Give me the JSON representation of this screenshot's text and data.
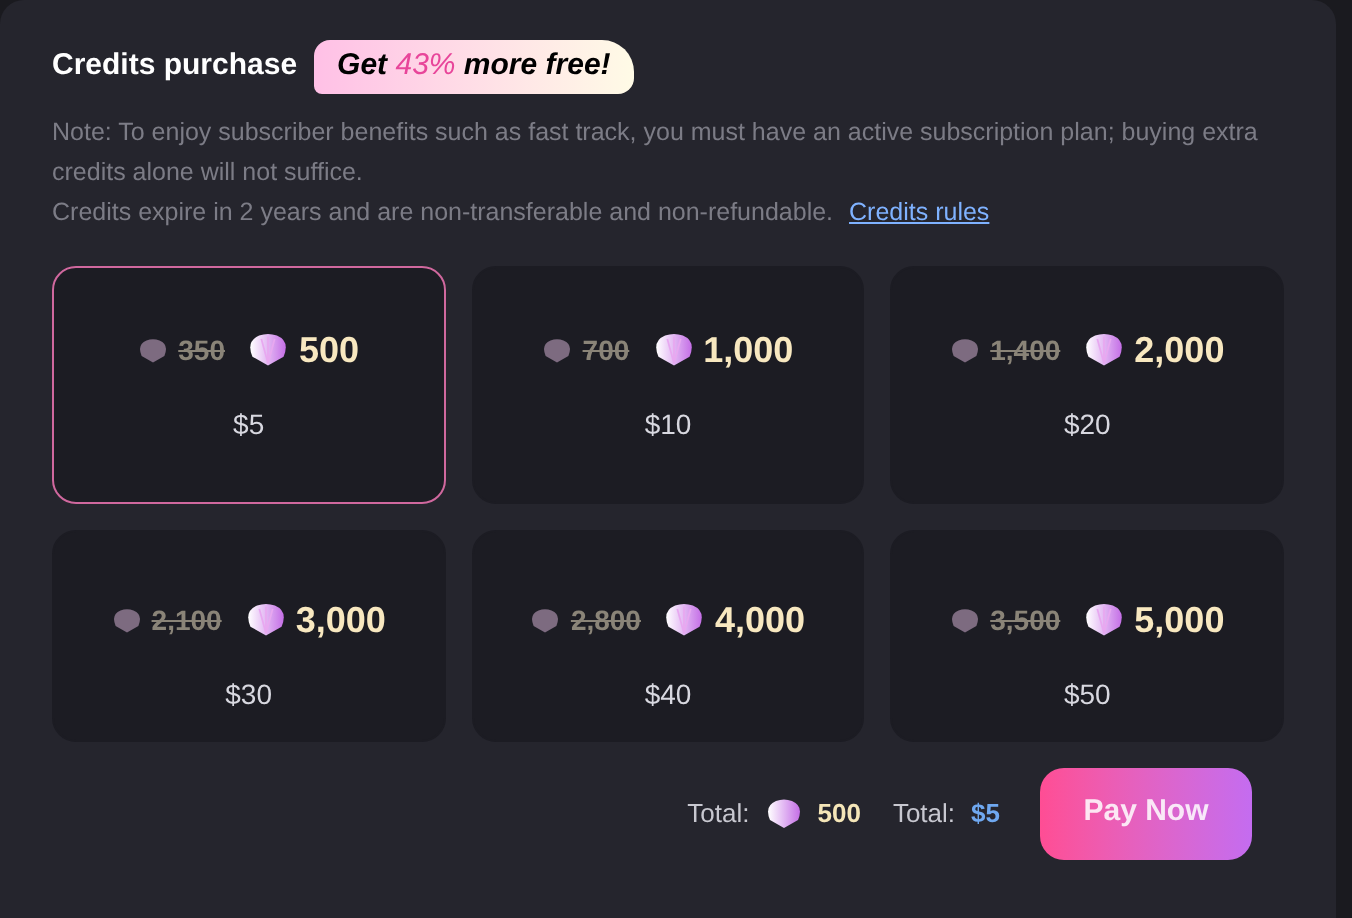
{
  "title": "Credits purchase",
  "badge": {
    "before": "Get",
    "highlight": "43%",
    "after": "more free!"
  },
  "notes": [
    "Note: To enjoy subscriber benefits such as fast track, you must have an active subscription plan; buying extra credits alone will not suffice.",
    "Credits expire in 2 years and are non-transferable and non-refundable."
  ],
  "rules_link": "Credits rules",
  "packages": [
    {
      "old": "350",
      "credits": "500",
      "price": "$5",
      "selected": true
    },
    {
      "old": "700",
      "credits": "1,000",
      "price": "$10",
      "selected": false
    },
    {
      "old": "1,400",
      "credits": "2,000",
      "price": "$20",
      "selected": false
    },
    {
      "old": "2,100",
      "credits": "3,000",
      "price": "$30",
      "selected": false
    },
    {
      "old": "2,800",
      "credits": "4,000",
      "price": "$40",
      "selected": false
    },
    {
      "old": "3,500",
      "credits": "5,000",
      "price": "$50",
      "selected": false
    }
  ],
  "footer": {
    "credits_label": "Total:",
    "credits": "500",
    "price_label": "Total:",
    "price": "$5",
    "button": "Pay Now"
  }
}
